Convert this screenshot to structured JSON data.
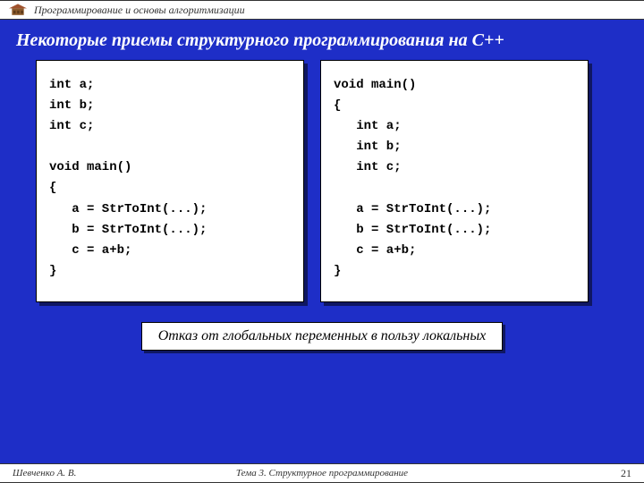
{
  "header": {
    "course": "Программирование и основы алгоритмизации"
  },
  "title": "Некоторые приемы структурного программирования на С++",
  "code": {
    "left": "int a;\nint b;\nint c;\n\nvoid main()\n{\n   a = StrToInt(...);\n   b = StrToInt(...);\n   c = a+b;\n}",
    "right": "void main()\n{\n   int a;\n   int b;\n   int c;\n\n   a = StrToInt(...);\n   b = StrToInt(...);\n   c = a+b;\n}"
  },
  "note": "Отказ от глобальных переменных в пользу локальных",
  "footer": {
    "author": "Шевченко А. В.",
    "topic": "Тема 3. Структурное программирование",
    "page": "21"
  }
}
